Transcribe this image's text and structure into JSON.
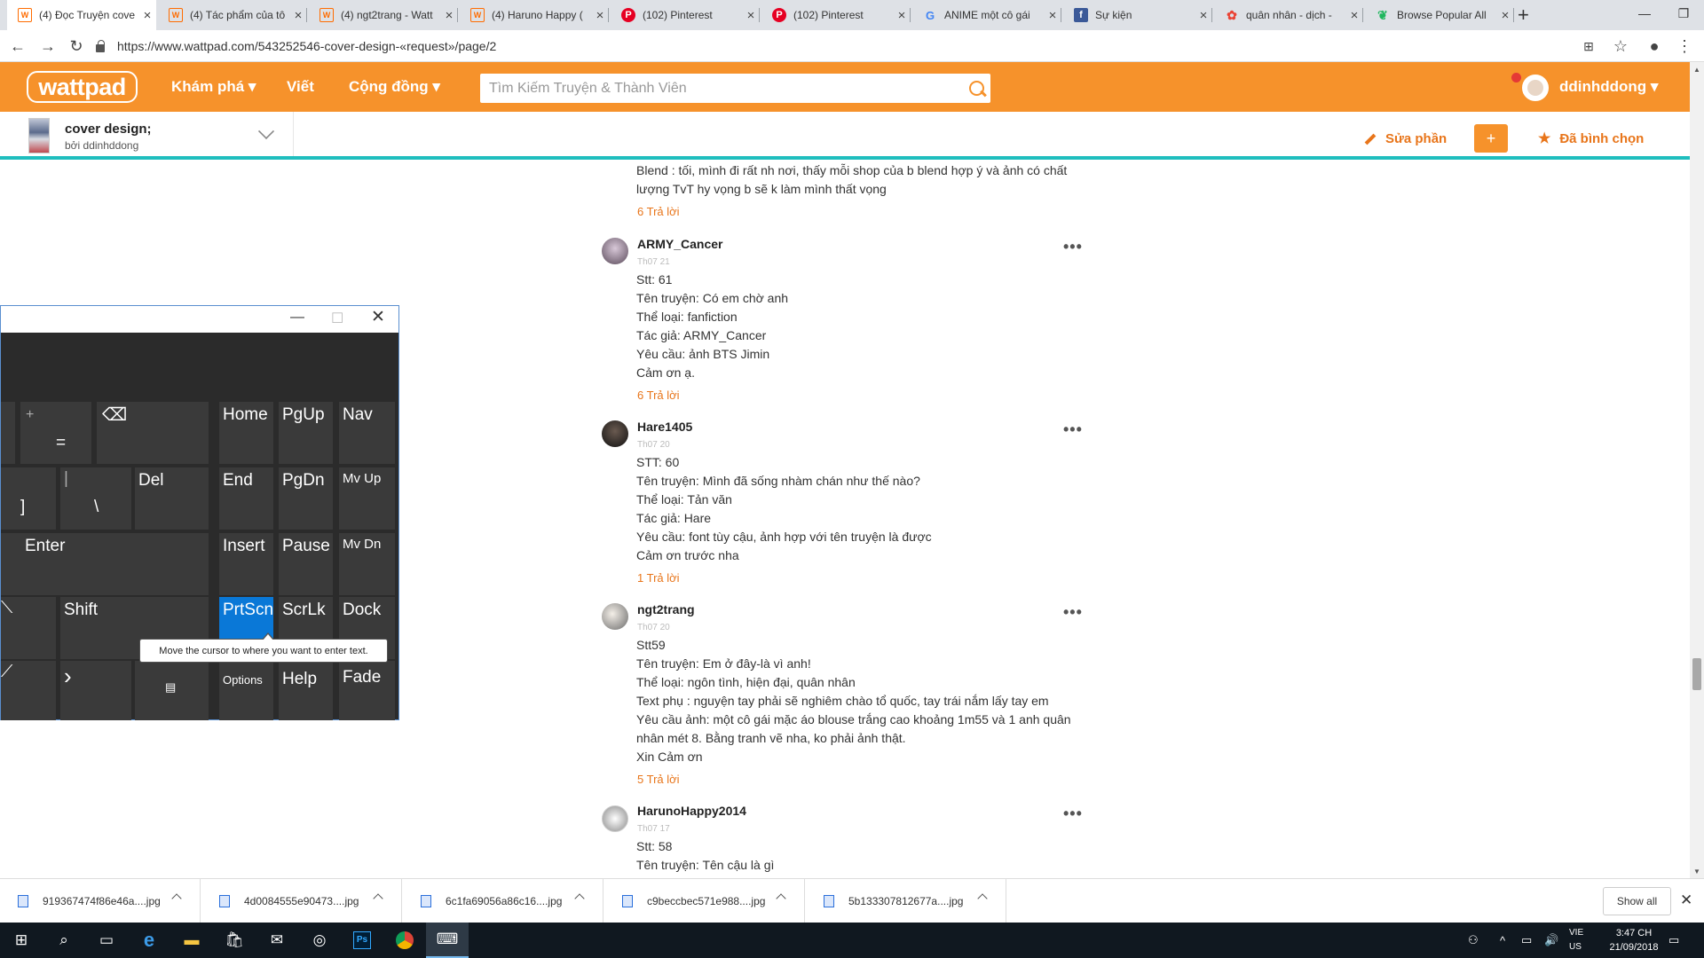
{
  "browser": {
    "tabs": [
      {
        "title": "(4) Đọc Truyện cove",
        "icon": "wattpad-icon",
        "active": true
      },
      {
        "title": "(4) Tác phẩm của tô",
        "icon": "wattpad-icon",
        "active": false
      },
      {
        "title": "(4) ngt2trang - Watt",
        "icon": "wattpad-icon",
        "active": false
      },
      {
        "title": "(4) Haruno Happy (",
        "icon": "wattpad-icon",
        "active": false
      },
      {
        "title": "(102) Pinterest",
        "icon": "pinterest-icon",
        "active": false
      },
      {
        "title": "(102) Pinterest",
        "icon": "pinterest-icon",
        "active": false
      },
      {
        "title": "ANIME một cô gái",
        "icon": "google-icon",
        "active": false
      },
      {
        "title": "Sự kiện",
        "icon": "facebook-icon",
        "active": false
      },
      {
        "title": "quân nhân - dịch -",
        "icon": "google-photos-icon",
        "active": false
      },
      {
        "title": "Browse Popular All",
        "icon": "feather-icon",
        "active": false
      }
    ],
    "url": "https://www.wattpad.com/543252546-cover-design-«request»/page/2"
  },
  "wattpad": {
    "logo": "wattpad",
    "nav": {
      "explore": "Khám phá ▾",
      "write": "Viết",
      "community": "Cộng đồng ▾"
    },
    "search_placeholder": "Tìm Kiếm Truyện & Thành Viên",
    "username": "ddinhddong ▾",
    "story": {
      "title": "cover design;",
      "author": "bởi ddinhddong"
    },
    "actions": {
      "edit": "Sửa phần",
      "add": "+",
      "voted": "Đã bình chọn"
    }
  },
  "comments_top": {
    "lines": [
      "Blend : tối, mình đi rất nh nơi, thấy mỗi shop của b blend hợp ý và ảnh có chất",
      "lượng TvT hy vọng b sẽ k làm mình thất vọng"
    ],
    "replies": "6 Trả lời"
  },
  "comments": [
    {
      "author": "ARMY_Cancer",
      "date": "Th07 21",
      "lines": [
        "Stt: 61",
        "Tên truyện: Có em chờ anh",
        "Thể loại: fanfiction",
        "Tác giả: ARMY_Cancer",
        "Yêu cầu: ảnh BTS Jimin",
        "Cảm ơn ạ."
      ],
      "replies": "6 Trả lời"
    },
    {
      "author": "Hare1405",
      "date": "Th07 20",
      "lines": [
        "STT: 60",
        "Tên truyện: Mình đã sống nhàm chán như thế nào?",
        "Thể loại: Tản văn",
        "Tác giả: Hare",
        "Yêu cầu: font tùy cậu, ảnh hợp với tên truyện là được",
        "Cảm ơn trước nha"
      ],
      "replies": "1 Trả lời"
    },
    {
      "author": "ngt2trang",
      "date": "Th07 20",
      "lines": [
        "Stt59",
        "Tên truyện: Em ở đây-là vì anh!",
        "Thể loại: ngôn tình, hiện đại, quân nhân",
        "Text phụ : nguyện tay phải sẽ nghiêm chào tổ quốc, tay trái nắm lấy tay em",
        "Yêu cầu ảnh: một cô gái mặc áo blouse trắng cao khoảng 1m55 và 1 anh quân",
        "nhân mét 8. Bằng tranh vẽ nha,  ko phải ảnh thật.",
        "Xin Cảm ơn"
      ],
      "replies": "5 Trả lời"
    },
    {
      "author": "HarunoHappy2014",
      "date": "Th07 17",
      "lines": [
        "Stt: 58",
        "Tên truyện: Tên cậu là gì"
      ],
      "replies": ""
    }
  ],
  "keyboard": {
    "keys": {
      "plus": "+",
      "equals": "=",
      "home": "Home",
      "pgup": "PgUp",
      "nav": "Nav",
      "bracket": "]",
      "pipe": "|",
      "backslash": "\\",
      "del": "Del",
      "end": "End",
      "pgdn": "PgDn",
      "mvup": "Mv Up",
      "enter": "Enter",
      "insert": "Insert",
      "pause": "Pause",
      "mvdn": "Mv Dn",
      "shift": "Shift",
      "prtscn": "PrtScn",
      "scrlk": "ScrLk",
      "dock": "Dock",
      "options": "Options",
      "help": "Help",
      "fade": "Fade"
    },
    "tooltip": "Move the cursor to where you want to enter text."
  },
  "downloads": {
    "files": [
      "919367474f86e46a....jpg",
      "4d0084555e90473....jpg",
      "6c1fa69056a86c16....jpg",
      "c9beccbec571e988....jpg",
      "5b133307812677a....jpg"
    ],
    "show_all": "Show all"
  },
  "taskbar": {
    "lang": "VIE",
    "lang_sub": "US",
    "time": "3:47 CH",
    "date": "21/09/2018"
  }
}
